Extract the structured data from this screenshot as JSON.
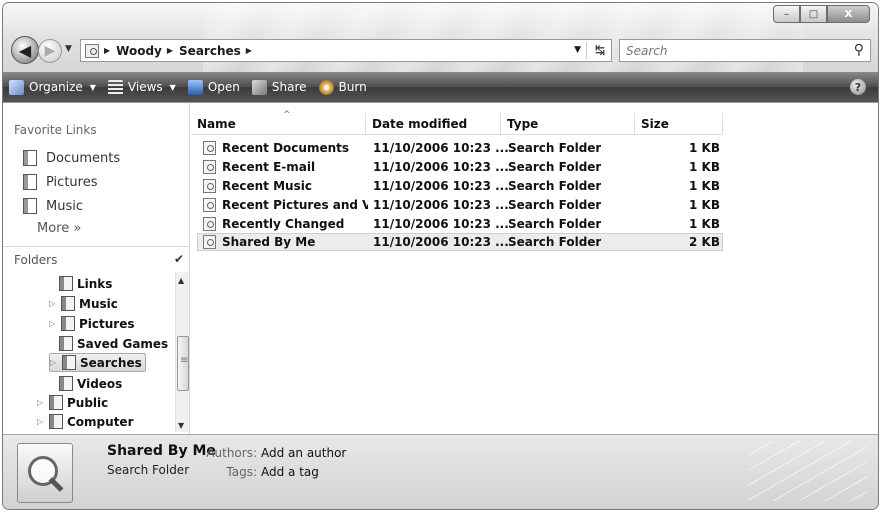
{
  "caption": {
    "minimize": "–",
    "maximize": "□",
    "close": "X"
  },
  "nav": {
    "back_glyph": "◀",
    "forward_glyph": "▶",
    "breadcrumb": [
      "Woody",
      "Searches"
    ],
    "search_placeholder": "Search"
  },
  "toolbar": {
    "items": [
      {
        "label": "Organize",
        "dropdown": true,
        "icon": "organize-icon"
      },
      {
        "label": "Views",
        "dropdown": true,
        "icon": "views-icon"
      },
      {
        "label": "Open",
        "dropdown": false,
        "icon": "open-icon"
      },
      {
        "label": "Share",
        "dropdown": false,
        "icon": "share-icon"
      },
      {
        "label": "Burn",
        "dropdown": false,
        "icon": "burn-icon"
      }
    ],
    "help": "?"
  },
  "favorites": {
    "heading": "Favorite Links",
    "items": [
      "Documents",
      "Pictures",
      "Music"
    ],
    "more": "More »"
  },
  "folders": {
    "heading": "Folders",
    "tree": [
      {
        "label": "Links",
        "expander": false
      },
      {
        "label": "Music",
        "expander": true
      },
      {
        "label": "Pictures",
        "expander": true
      },
      {
        "label": "Saved Games",
        "expander": false
      },
      {
        "label": "Searches",
        "expander": true,
        "selected": true
      },
      {
        "label": "Videos",
        "expander": false
      },
      {
        "label": "Public",
        "expander": true
      },
      {
        "label": "Computer",
        "expander": true
      }
    ]
  },
  "file_list": {
    "columns": [
      "Name",
      "Date modified",
      "Type",
      "Size"
    ],
    "rows": [
      {
        "name": "Recent Documents",
        "date": "11/10/2006 10:23 ...",
        "type": "Search Folder",
        "size": "1 KB"
      },
      {
        "name": "Recent E-mail",
        "date": "11/10/2006 10:23 ...",
        "type": "Search Folder",
        "size": "1 KB"
      },
      {
        "name": "Recent Music",
        "date": "11/10/2006 10:23 ...",
        "type": "Search Folder",
        "size": "1 KB"
      },
      {
        "name": "Recent Pictures and Vi...",
        "date": "11/10/2006 10:23 ...",
        "type": "Search Folder",
        "size": "1 KB"
      },
      {
        "name": "Recently Changed",
        "date": "11/10/2006 10:23 ...",
        "type": "Search Folder",
        "size": "1 KB"
      },
      {
        "name": "Shared By Me",
        "date": "11/10/2006 10:23 ...",
        "type": "Search Folder",
        "size": "2 KB",
        "selected": true
      }
    ]
  },
  "details": {
    "name": "Shared By Me",
    "type": "Search Folder",
    "authors_label": "Authors:",
    "authors_value": "Add an author",
    "tags_label": "Tags:",
    "tags_value": "Add a tag"
  },
  "colors": {
    "toolbar_bg": "#4d4d4d",
    "selection": "#ececec"
  }
}
